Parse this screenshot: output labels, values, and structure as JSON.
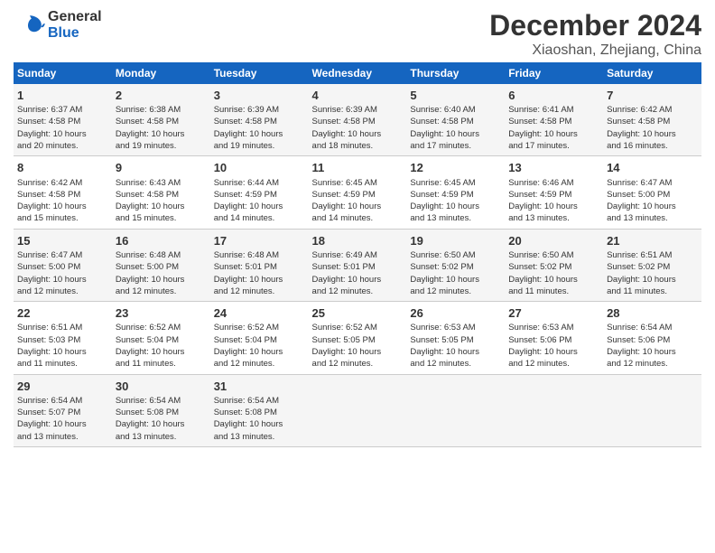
{
  "header": {
    "logo_general": "General",
    "logo_blue": "Blue",
    "month": "December 2024",
    "location": "Xiaoshan, Zhejiang, China"
  },
  "days_of_week": [
    "Sunday",
    "Monday",
    "Tuesday",
    "Wednesday",
    "Thursday",
    "Friday",
    "Saturday"
  ],
  "weeks": [
    [
      {
        "day": "1",
        "info": "Sunrise: 6:37 AM\nSunset: 4:58 PM\nDaylight: 10 hours\nand 20 minutes."
      },
      {
        "day": "2",
        "info": "Sunrise: 6:38 AM\nSunset: 4:58 PM\nDaylight: 10 hours\nand 19 minutes."
      },
      {
        "day": "3",
        "info": "Sunrise: 6:39 AM\nSunset: 4:58 PM\nDaylight: 10 hours\nand 19 minutes."
      },
      {
        "day": "4",
        "info": "Sunrise: 6:39 AM\nSunset: 4:58 PM\nDaylight: 10 hours\nand 18 minutes."
      },
      {
        "day": "5",
        "info": "Sunrise: 6:40 AM\nSunset: 4:58 PM\nDaylight: 10 hours\nand 17 minutes."
      },
      {
        "day": "6",
        "info": "Sunrise: 6:41 AM\nSunset: 4:58 PM\nDaylight: 10 hours\nand 17 minutes."
      },
      {
        "day": "7",
        "info": "Sunrise: 6:42 AM\nSunset: 4:58 PM\nDaylight: 10 hours\nand 16 minutes."
      }
    ],
    [
      {
        "day": "8",
        "info": "Sunrise: 6:42 AM\nSunset: 4:58 PM\nDaylight: 10 hours\nand 15 minutes."
      },
      {
        "day": "9",
        "info": "Sunrise: 6:43 AM\nSunset: 4:58 PM\nDaylight: 10 hours\nand 15 minutes."
      },
      {
        "day": "10",
        "info": "Sunrise: 6:44 AM\nSunset: 4:59 PM\nDaylight: 10 hours\nand 14 minutes."
      },
      {
        "day": "11",
        "info": "Sunrise: 6:45 AM\nSunset: 4:59 PM\nDaylight: 10 hours\nand 14 minutes."
      },
      {
        "day": "12",
        "info": "Sunrise: 6:45 AM\nSunset: 4:59 PM\nDaylight: 10 hours\nand 13 minutes."
      },
      {
        "day": "13",
        "info": "Sunrise: 6:46 AM\nSunset: 4:59 PM\nDaylight: 10 hours\nand 13 minutes."
      },
      {
        "day": "14",
        "info": "Sunrise: 6:47 AM\nSunset: 5:00 PM\nDaylight: 10 hours\nand 13 minutes."
      }
    ],
    [
      {
        "day": "15",
        "info": "Sunrise: 6:47 AM\nSunset: 5:00 PM\nDaylight: 10 hours\nand 12 minutes."
      },
      {
        "day": "16",
        "info": "Sunrise: 6:48 AM\nSunset: 5:00 PM\nDaylight: 10 hours\nand 12 minutes."
      },
      {
        "day": "17",
        "info": "Sunrise: 6:48 AM\nSunset: 5:01 PM\nDaylight: 10 hours\nand 12 minutes."
      },
      {
        "day": "18",
        "info": "Sunrise: 6:49 AM\nSunset: 5:01 PM\nDaylight: 10 hours\nand 12 minutes."
      },
      {
        "day": "19",
        "info": "Sunrise: 6:50 AM\nSunset: 5:02 PM\nDaylight: 10 hours\nand 12 minutes."
      },
      {
        "day": "20",
        "info": "Sunrise: 6:50 AM\nSunset: 5:02 PM\nDaylight: 10 hours\nand 11 minutes."
      },
      {
        "day": "21",
        "info": "Sunrise: 6:51 AM\nSunset: 5:02 PM\nDaylight: 10 hours\nand 11 minutes."
      }
    ],
    [
      {
        "day": "22",
        "info": "Sunrise: 6:51 AM\nSunset: 5:03 PM\nDaylight: 10 hours\nand 11 minutes."
      },
      {
        "day": "23",
        "info": "Sunrise: 6:52 AM\nSunset: 5:04 PM\nDaylight: 10 hours\nand 11 minutes."
      },
      {
        "day": "24",
        "info": "Sunrise: 6:52 AM\nSunset: 5:04 PM\nDaylight: 10 hours\nand 12 minutes."
      },
      {
        "day": "25",
        "info": "Sunrise: 6:52 AM\nSunset: 5:05 PM\nDaylight: 10 hours\nand 12 minutes."
      },
      {
        "day": "26",
        "info": "Sunrise: 6:53 AM\nSunset: 5:05 PM\nDaylight: 10 hours\nand 12 minutes."
      },
      {
        "day": "27",
        "info": "Sunrise: 6:53 AM\nSunset: 5:06 PM\nDaylight: 10 hours\nand 12 minutes."
      },
      {
        "day": "28",
        "info": "Sunrise: 6:54 AM\nSunset: 5:06 PM\nDaylight: 10 hours\nand 12 minutes."
      }
    ],
    [
      {
        "day": "29",
        "info": "Sunrise: 6:54 AM\nSunset: 5:07 PM\nDaylight: 10 hours\nand 13 minutes."
      },
      {
        "day": "30",
        "info": "Sunrise: 6:54 AM\nSunset: 5:08 PM\nDaylight: 10 hours\nand 13 minutes."
      },
      {
        "day": "31",
        "info": "Sunrise: 6:54 AM\nSunset: 5:08 PM\nDaylight: 10 hours\nand 13 minutes."
      },
      {
        "day": "",
        "info": ""
      },
      {
        "day": "",
        "info": ""
      },
      {
        "day": "",
        "info": ""
      },
      {
        "day": "",
        "info": ""
      }
    ]
  ]
}
